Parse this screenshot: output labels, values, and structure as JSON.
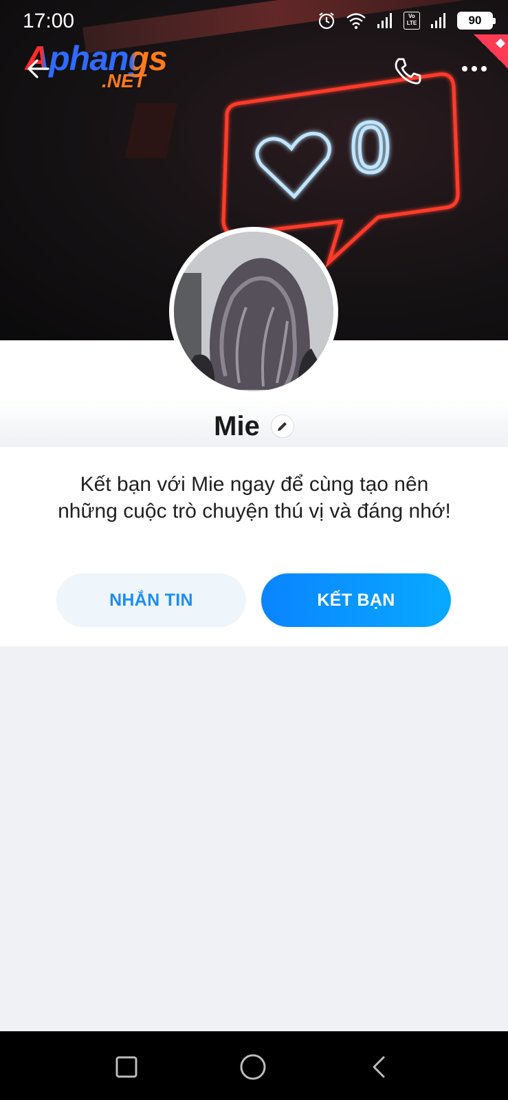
{
  "status_bar": {
    "time": "17:00",
    "network_label": "Vo LTE",
    "battery": "90",
    "icons": [
      "alarm-icon",
      "wifi-icon",
      "signal-icon",
      "volte-icon",
      "signal-icon",
      "battery-icon"
    ]
  },
  "watermark": {
    "line1": "Aphangs",
    "line2": ".NET"
  },
  "cover": {
    "neon_count": "0"
  },
  "header_actions": {
    "back": "back-arrow-icon",
    "call": "phone-icon",
    "more": "more-dots-icon"
  },
  "profile": {
    "name": "Mie",
    "edit_icon": "pencil-icon",
    "invite_text": "Kết bạn với Mie ngay để cùng tạo nên những cuộc trò chuyện thú vị và đáng nhớ!"
  },
  "actions": {
    "message_label": "NHẮN TIN",
    "add_friend_label": "KẾT BẠN"
  },
  "colors": {
    "accent": "#0a84ff",
    "message_bg": "#eef5fb",
    "message_text": "#1b8ef2",
    "page_bg": "#eff1f5"
  },
  "nav": {
    "items": [
      "recent-apps-icon",
      "home-icon",
      "back-icon"
    ]
  }
}
